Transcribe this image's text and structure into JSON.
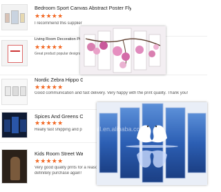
{
  "reviews": [
    {
      "title": "Bedroom Sport Canvas Abstract Poster Fly Du...",
      "rating": 5,
      "stars": "★★★★★",
      "text": "I recommend this supplier"
    },
    {
      "title": "Living Room Decoration Picture",
      "rating": 5,
      "stars": "★★★★★",
      "text": "Great product popular designs and"
    },
    {
      "title": "Nordic Zebra Hippo Giraf",
      "rating": 5,
      "stars": "★★★★★",
      "text": "Good communication and fast delivery. Very happy with the print quality. Thank you!"
    },
    {
      "title": "Spices And Greens On",
      "rating": 5,
      "stars": "★★★★★",
      "text": "Really fast shipping and p"
    },
    {
      "title": "Kids Room Street Wall gra",
      "rating": 5,
      "stars": "★★★★★",
      "text_line1": "Very good quality prnts for a reasonable price!  Seller very pleasant to deal with!  Packaged very well.  I will",
      "text_line2": "definitely purchase again!"
    }
  ],
  "watermark": "pvcmall.en.alibaba.com",
  "colors": {
    "star": "#f26722",
    "title": "#1a1a1a"
  }
}
